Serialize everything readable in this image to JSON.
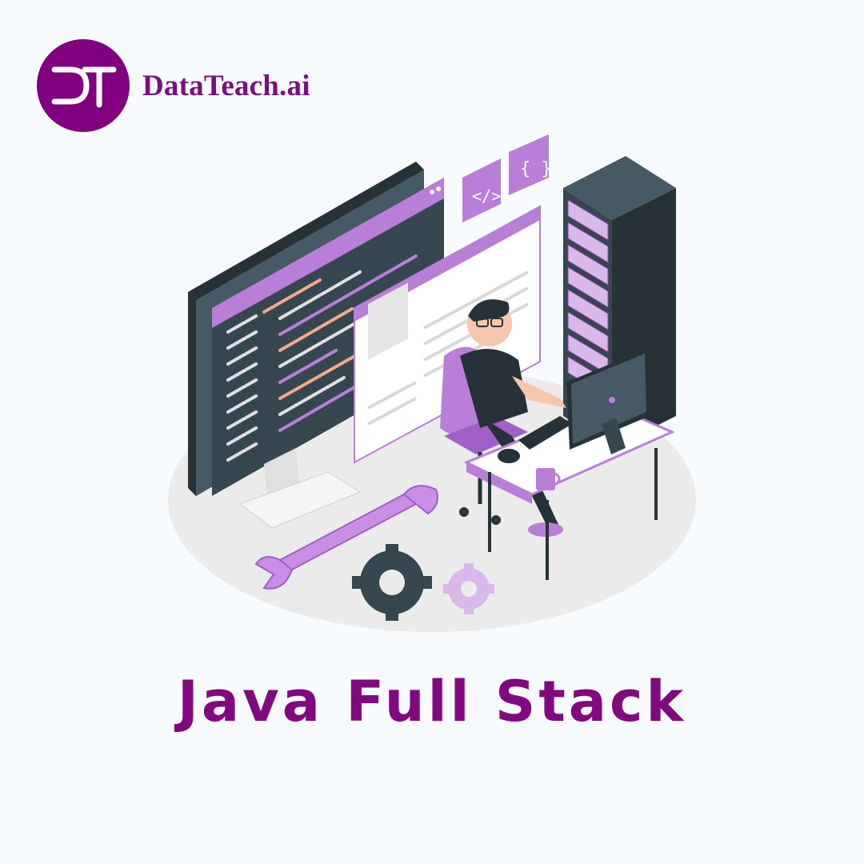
{
  "brand": {
    "monogram": "DT",
    "name": "DataTeach.ai",
    "color": "#800080"
  },
  "title": "Java Full Stack",
  "illustration": {
    "subject": "developer-at-desk-with-code-screens-and-server",
    "accent": "#b97fd8",
    "dark": "#37474f"
  }
}
